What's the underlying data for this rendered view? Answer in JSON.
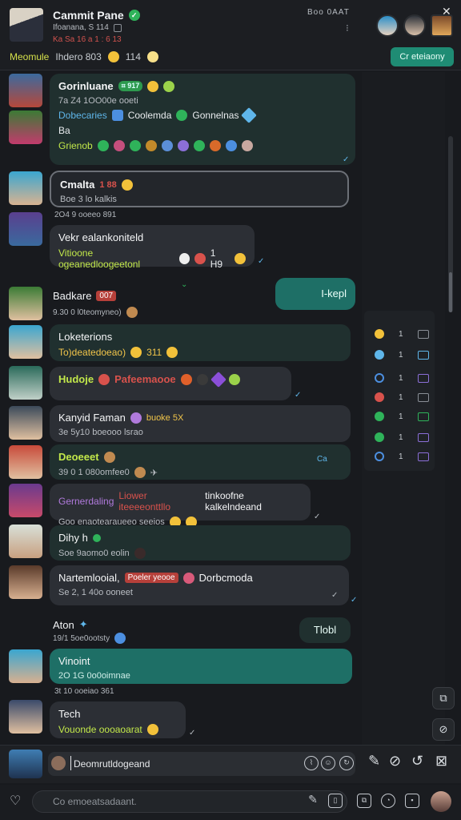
{
  "header": {
    "title": "Cammit Pane",
    "verified_icon": "check-circle-icon",
    "sub": "Ifoanana, S 114",
    "sub2": "Ka Sa 16 a 1 : 6 13",
    "status": "Boo  0AAT",
    "dots": "⁝",
    "meta_name": "Meomule",
    "meta_text": "Ihdero 803",
    "meta_num": "114",
    "button": "Cr eteiaony",
    "close": "✕",
    "accent": "#1f8c74"
  },
  "messages": [
    {
      "title": "Gorinluane",
      "badge": "⌗ 917",
      "time": "7a Z4 1OO00e ooeti",
      "line1": "Dobecaries",
      "line1b": "Coolemda",
      "line1c": "Gonnelnas",
      "line2": "Ba",
      "line3": "Grienob"
    },
    {
      "title": "Cmalta",
      "num": "1 88",
      "sub": "Boe 3 lo kalkis",
      "time": "2O4 9 ooeeo 891"
    },
    {
      "title": "Vekr ealankoniteld",
      "line": "Vitioone ogeanedloogeetonl",
      "num": "1 H9",
      "sender": ""
    },
    {
      "title": "Badkare",
      "tag": "007",
      "sub": "9.30 0 l0teomyneo)",
      "out": "I-kepl"
    },
    {
      "title": "Loketerions",
      "line": "To)deatedoeao)",
      "num": "311"
    },
    {
      "title": "Hudoje",
      "line": "Pafeemaooe"
    },
    {
      "title": "Kanyid Faman",
      "line": "buoke 5X",
      "time": "3e 5y10 boeooo lsrao"
    },
    {
      "title": "Deoeeet",
      "time": "39 0 1 080omfee0",
      "badge": "Ca"
    },
    {
      "title": "Gernerdaling",
      "title2": "Liower iteeeeonttllo",
      "title3": "tinkoofne kalkelndeand",
      "sub": "Goo enaotearaueeo seeios"
    },
    {
      "title": "Dihy h",
      "sub": "Soe 9aomo0 eolin"
    },
    {
      "title": "Nartemlooial,",
      "tag": "Poeler yeooe",
      "tail": "Dorbcmoda",
      "time": "Se 2, 1 40o ooneet"
    },
    {
      "title": "Aton",
      "time": "19/1 5oe0ootsty",
      "out": "Tlobl"
    },
    {
      "title": "Vinoint",
      "sub": "2O 1G 0o0oimnae",
      "time": "3t 10 ooeiao 361"
    },
    {
      "title": "Tech",
      "line": "Vouonde oooaoarat"
    }
  ],
  "rail": {
    "items": [
      {
        "num": "1",
        "color": "#f2c13a"
      },
      {
        "num": "1",
        "color": "#5fb6ea"
      },
      {
        "num": "1",
        "color": "#4c8fe0"
      },
      {
        "num": "1",
        "color": "#d8524c"
      },
      {
        "num": "1",
        "color": "#2fb35a"
      },
      {
        "num": "1",
        "color": "#2fb35a"
      },
      {
        "num": "1",
        "color": "#4c8fe0"
      }
    ]
  },
  "composer": {
    "text": "Deomrutldogeand"
  },
  "bottom": {
    "placeholder": "Co emoeatsadaant."
  }
}
